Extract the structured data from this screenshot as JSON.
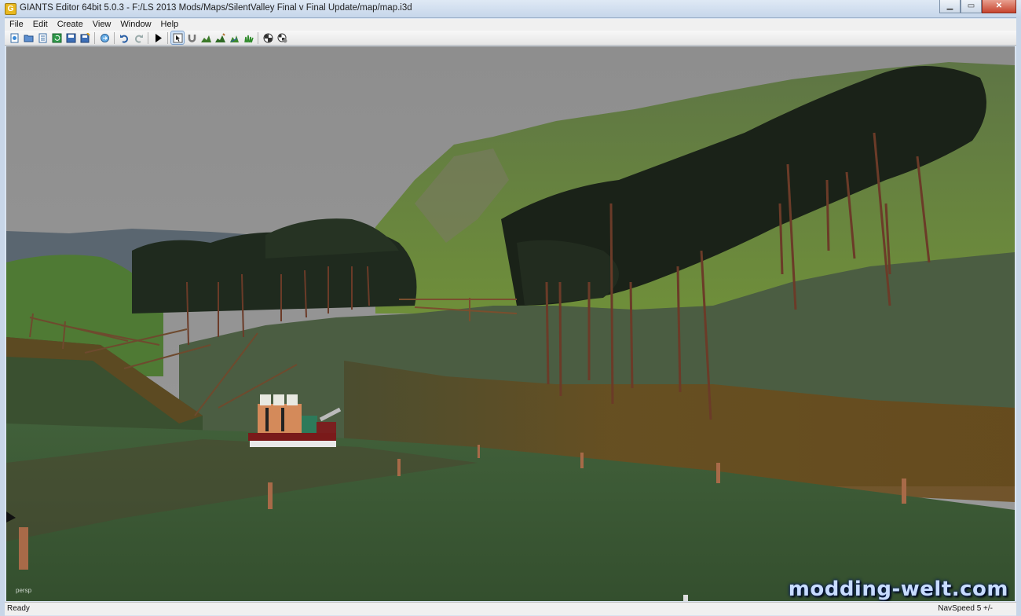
{
  "window": {
    "icon_label": "G",
    "title": "GIANTS Editor 64bit 5.0.3 - F:/LS 2013 Mods/Maps/SilentValley Final v Final Update/map/map.i3d",
    "minimize_label": "▁",
    "maximize_label": "▭",
    "close_label": "✕"
  },
  "menu": {
    "items": [
      "File",
      "Edit",
      "Create",
      "View",
      "Window",
      "Help"
    ]
  },
  "toolbar": {
    "buttons": [
      {
        "icon": "new-file-icon"
      },
      {
        "icon": "open-folder-icon"
      },
      {
        "icon": "properties-icon"
      },
      {
        "icon": "refresh-icon"
      },
      {
        "icon": "save-icon"
      },
      {
        "icon": "save-all-icon"
      },
      {
        "icon": "separator"
      },
      {
        "icon": "export-icon"
      },
      {
        "icon": "separator"
      },
      {
        "icon": "undo-icon"
      },
      {
        "icon": "redo-icon"
      },
      {
        "icon": "separator"
      },
      {
        "icon": "play-icon"
      },
      {
        "icon": "separator"
      },
      {
        "icon": "select-mode-icon",
        "active": true
      },
      {
        "icon": "magnet-icon"
      },
      {
        "icon": "terrain-sculpt-icon"
      },
      {
        "icon": "terrain-paint-icon"
      },
      {
        "icon": "foliage-paint-icon"
      },
      {
        "icon": "grass-paint-icon"
      },
      {
        "icon": "separator"
      },
      {
        "icon": "checker-icon"
      },
      {
        "icon": "checker-settings-icon"
      }
    ]
  },
  "viewport": {
    "camera_label": "persp",
    "watermark": "modding-welt.com"
  },
  "status": {
    "left": "Ready",
    "right": "NavSpeed 5 +/-"
  },
  "colors": {
    "sky": "#8f8f8f",
    "grass": "#3e5a32",
    "tree_trunk": "#6b3b28",
    "watermark": "#c8dcff"
  }
}
